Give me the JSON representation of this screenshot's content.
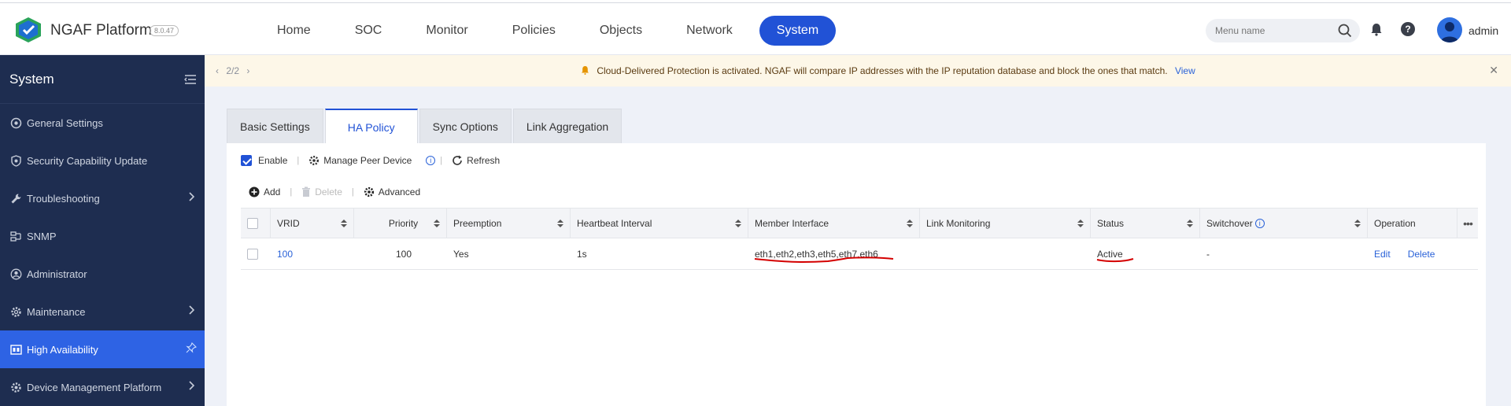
{
  "app": {
    "brand": "NGAF Platform",
    "version": "8.0.47",
    "user": "admin"
  },
  "nav": {
    "items": [
      "Home",
      "SOC",
      "Monitor",
      "Policies",
      "Objects",
      "Network",
      "System"
    ],
    "active": "System"
  },
  "search": {
    "placeholder": "Menu name"
  },
  "sidebar": {
    "title": "System",
    "items": [
      {
        "label": "General Settings",
        "icon": "gear-circle-icon",
        "has_children": false
      },
      {
        "label": "Security Capability Update",
        "icon": "shield-icon",
        "has_children": false
      },
      {
        "label": "Troubleshooting",
        "icon": "wrench-icon",
        "has_children": true
      },
      {
        "label": "SNMP",
        "icon": "network-icon",
        "has_children": false
      },
      {
        "label": "Administrator",
        "icon": "user-icon",
        "has_children": false
      },
      {
        "label": "Maintenance",
        "icon": "gear-icon",
        "has_children": true
      },
      {
        "label": "High Availability",
        "icon": "ha-icon",
        "has_children": false,
        "active": true
      },
      {
        "label": "Device Management Platform",
        "icon": "device-icon",
        "has_children": true
      }
    ]
  },
  "notice": {
    "pager": "2/2",
    "text": "Cloud-Delivered Protection is activated. NGAF will compare IP addresses with the IP reputation database and block the ones that match.",
    "link": "View"
  },
  "tabs": {
    "items": [
      "Basic Settings",
      "HA Policy",
      "Sync Options",
      "Link Aggregation"
    ],
    "active": "HA Policy"
  },
  "toolbar": {
    "enable_label": "Enable",
    "manage_peer_label": "Manage Peer Device",
    "refresh_label": "Refresh",
    "add_label": "Add",
    "delete_label": "Delete",
    "advanced_label": "Advanced"
  },
  "table": {
    "columns": [
      "VRID",
      "Priority",
      "Preemption",
      "Heartbeat Interval",
      "Member Interface",
      "Link Monitoring",
      "Status",
      "Switchover",
      "Operation"
    ],
    "rows": [
      {
        "vrid": "100",
        "priority": "100",
        "preemption": "Yes",
        "heartbeat": "1s",
        "member_interface": "eth1,eth2,eth3,eth5,eth7,eth6",
        "link_monitoring": "",
        "status": "Active",
        "switchover": "-",
        "edit_label": "Edit",
        "delete_label": "Delete"
      }
    ]
  },
  "colors": {
    "accent": "#2152d6",
    "sidebar_bg": "#1e2d50",
    "link": "#2a62d8",
    "annotation": "#d40000"
  }
}
